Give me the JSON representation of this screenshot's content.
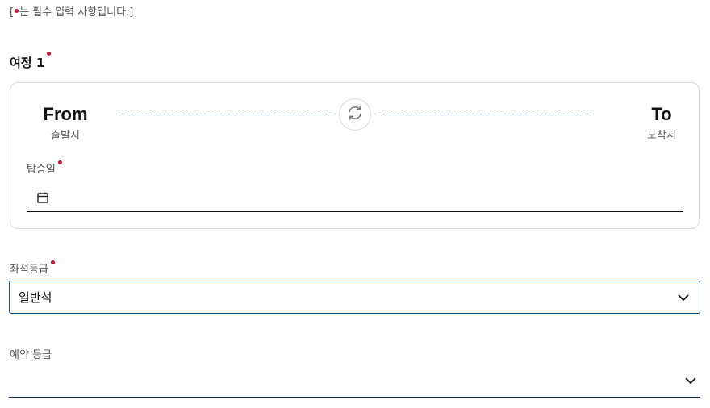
{
  "notice": {
    "prefix": "[",
    "text": "는 필수 입력 사항입니다.]"
  },
  "journey": {
    "title": "여정 1",
    "from": {
      "main": "From",
      "sub": "출발지"
    },
    "to": {
      "main": "To",
      "sub": "도착지"
    },
    "swap_icon": "swap-icon",
    "date": {
      "label": "탑승일",
      "value": "",
      "icon": "calendar-icon"
    }
  },
  "seat_class": {
    "label": "좌석등급",
    "value": "일반석",
    "icon": "chevron-down-icon"
  },
  "booking_class": {
    "label": "예약 등급",
    "value": "",
    "icon": "chevron-down-icon"
  },
  "colors": {
    "required": "#c8102e",
    "accent": "#0b4f8a",
    "border": "#d9d9d9"
  }
}
